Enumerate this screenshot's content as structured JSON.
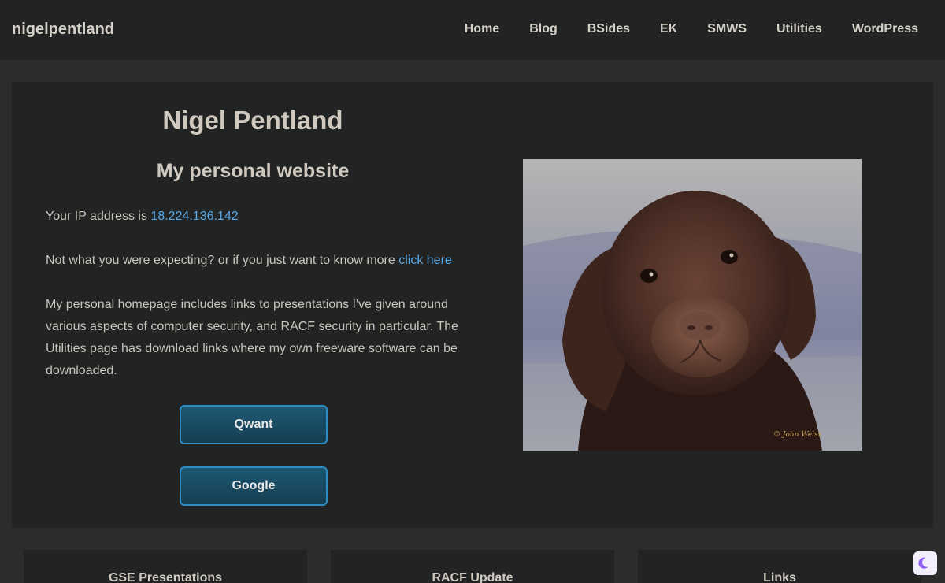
{
  "header": {
    "brand": "nigelpentland",
    "nav": [
      "Home",
      "Blog",
      "BSides",
      "EK",
      "SMWS",
      "Utilities",
      "WordPress"
    ]
  },
  "hero": {
    "title": "Nigel Pentland",
    "subtitle": "My personal website",
    "ip_prefix": "Your IP address is ",
    "ip_value": "18.224.136.142",
    "expect_prefix": "Not what you were expecting? or if you just want to know more ",
    "expect_link": "click here",
    "description": "My personal homepage includes links to presentations I've given around various aspects of computer security, and RACF security in particular. The Utilities page has download links where my own freeware software can be downloaded.",
    "buttons": [
      "Qwant",
      "Google"
    ],
    "image_signature": "© John Weiss"
  },
  "cards": [
    "GSE Presentations",
    "RACF Update",
    "Links"
  ],
  "colors": {
    "accent_link": "#5aa7e6",
    "button_border": "#2d8cc4",
    "panel": "#222423"
  },
  "icons": {
    "theme_toggle": "moon-icon"
  }
}
